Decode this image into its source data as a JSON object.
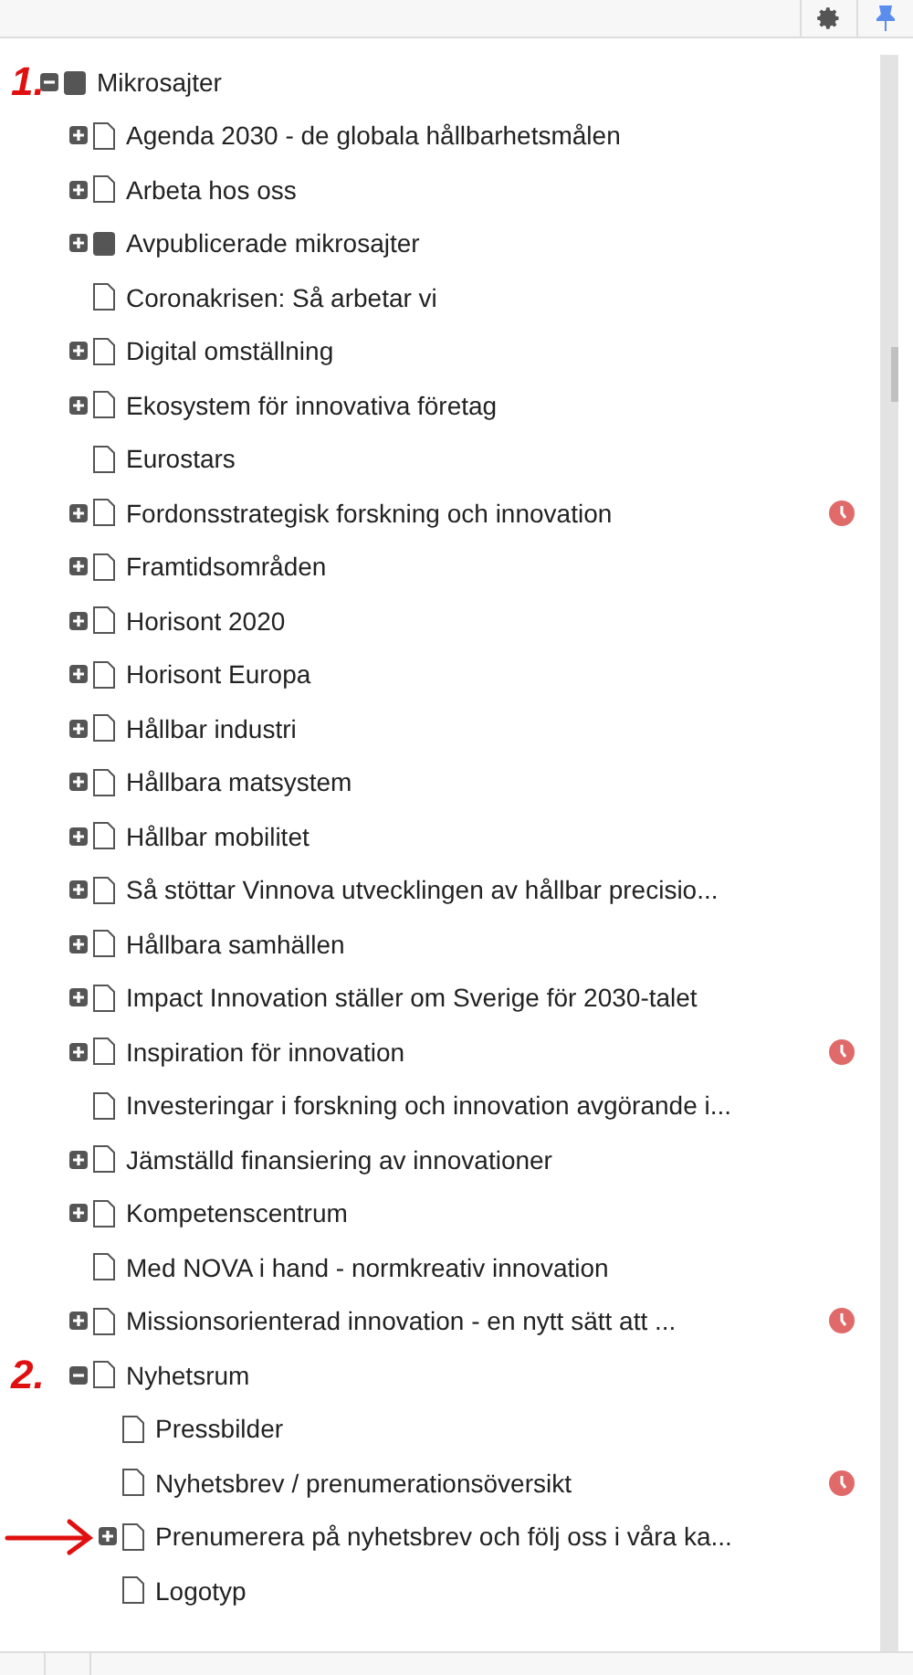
{
  "tree": [
    {
      "label": "Mikrosajter",
      "kind": "folder",
      "expanded": true,
      "scheduled": false,
      "mark": {
        "kind": "text",
        "text": "1."
      },
      "children": [
        {
          "label": "Agenda 2030 - de globala hållbarhetsmålen",
          "kind": "page",
          "expanded": false,
          "scheduled": false
        },
        {
          "label": "Arbeta hos oss",
          "kind": "page",
          "expanded": false,
          "scheduled": false
        },
        {
          "label": "Avpublicerade mikrosajter",
          "kind": "folder",
          "expanded": false,
          "scheduled": false
        },
        {
          "label": "Coronakrisen: Så arbetar vi",
          "kind": "page",
          "scheduled": false
        },
        {
          "label": "Digital omställning",
          "kind": "page",
          "expanded": false,
          "scheduled": false
        },
        {
          "label": "Ekosystem för innovativa företag",
          "kind": "page",
          "expanded": false,
          "scheduled": false
        },
        {
          "label": "Eurostars",
          "kind": "page",
          "scheduled": false
        },
        {
          "label": "Fordonsstrategisk forskning och innovation",
          "kind": "page",
          "expanded": false,
          "scheduled": true
        },
        {
          "label": "Framtidsområden",
          "kind": "page",
          "expanded": false,
          "scheduled": false
        },
        {
          "label": "Horisont 2020",
          "kind": "page",
          "expanded": false,
          "scheduled": false
        },
        {
          "label": "Horisont Europa",
          "kind": "page",
          "expanded": false,
          "scheduled": false
        },
        {
          "label": "Hållbar industri",
          "kind": "page",
          "expanded": false,
          "scheduled": false
        },
        {
          "label": "Hållbara matsystem",
          "kind": "page",
          "expanded": false,
          "scheduled": false
        },
        {
          "label": "Hållbar mobilitet",
          "kind": "page",
          "expanded": false,
          "scheduled": false
        },
        {
          "label": "Så stöttar Vinnova utvecklingen av hållbar precisio...",
          "kind": "page",
          "expanded": false,
          "scheduled": false
        },
        {
          "label": "Hållbara samhällen",
          "kind": "page",
          "expanded": false,
          "scheduled": false
        },
        {
          "label": "Impact Innovation ställer om Sverige för 2030-talet",
          "kind": "page",
          "expanded": false,
          "scheduled": false
        },
        {
          "label": "Inspiration för innovation",
          "kind": "page",
          "expanded": false,
          "scheduled": true
        },
        {
          "label": "Investeringar i forskning och innovation avgörande i...",
          "kind": "page",
          "scheduled": false
        },
        {
          "label": "Jämställd finansiering av innovationer",
          "kind": "page",
          "expanded": false,
          "scheduled": false
        },
        {
          "label": "Kompetenscentrum",
          "kind": "page",
          "expanded": false,
          "scheduled": false
        },
        {
          "label": "Med NOVA i hand - normkreativ innovation",
          "kind": "page",
          "scheduled": false
        },
        {
          "label": "Missionsorienterad innovation - en nytt sätt att ...",
          "kind": "page",
          "expanded": false,
          "scheduled": true
        },
        {
          "label": "Nyhetsrum",
          "kind": "page",
          "expanded": true,
          "scheduled": false,
          "mark": {
            "kind": "text",
            "text": "2."
          },
          "children": [
            {
              "label": "Pressbilder",
              "kind": "page",
              "scheduled": false
            },
            {
              "label": "Nyhetsbrev / prenumerationsöversikt",
              "kind": "page",
              "scheduled": true
            },
            {
              "label": "Prenumerera på nyhetsbrev och följ oss i våra ka...",
              "kind": "page",
              "expanded": false,
              "scheduled": false,
              "mark": {
                "kind": "arrow"
              }
            },
            {
              "label": "Logotyp",
              "kind": "page",
              "scheduled": false
            }
          ]
        }
      ]
    }
  ]
}
